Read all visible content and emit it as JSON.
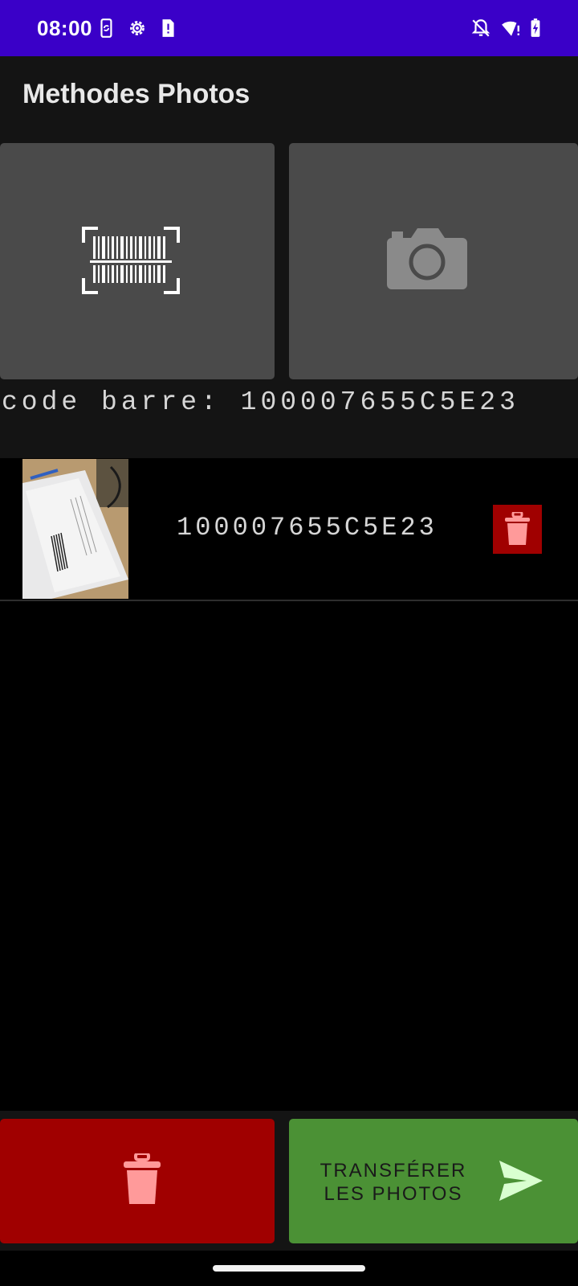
{
  "status_bar": {
    "time": "08:00",
    "left_icons": [
      "phone-sync-icon",
      "settings-gear-icon",
      "sim-alert-icon"
    ],
    "right_icons": [
      "notifications-off-icon",
      "wifi-alert-icon",
      "battery-charging-icon"
    ]
  },
  "app_bar": {
    "title": "Methodes Photos"
  },
  "methods": {
    "scan_icon": "barcode-scan-icon",
    "camera_icon": "camera-icon",
    "barcode_readout": "code barre: 100007655C5E23"
  },
  "photos": [
    {
      "code": "100007655C5E23",
      "delete_icon": "trash-icon"
    }
  ],
  "bottom_bar": {
    "delete_all_icon": "trash-icon",
    "transfer_label_line1": "TRANSFÉRER",
    "transfer_label_line2": "LES PHOTOS",
    "transfer_icon": "send-icon"
  },
  "colors": {
    "status_bar": "#3a00c8",
    "app_bar": "#141414",
    "tile": "#4a4a4a",
    "danger": "#a00000",
    "success": "#4b9135",
    "icon_pink": "#ff9a9a",
    "icon_green": "#d9ffd0"
  }
}
